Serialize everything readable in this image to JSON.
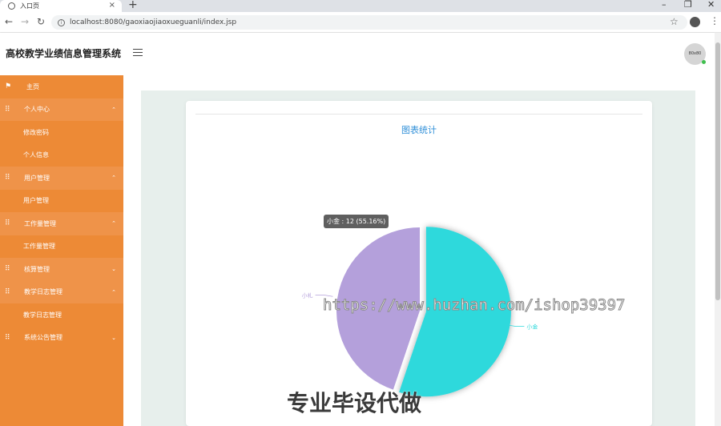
{
  "browser": {
    "tab_title": "入口页",
    "tab_close": "×",
    "new_tab": "+",
    "url": "localhost:8080/gaoxiaojiaoxueguanli/index.jsp",
    "win_min": "–",
    "win_max": "❐",
    "win_close": "✕"
  },
  "header": {
    "title": "高校教学业绩信息管理系统",
    "avatar_text": "80x80"
  },
  "sidebar": {
    "items": [
      {
        "label": "主页"
      },
      {
        "label": "个人中心"
      },
      {
        "label": "修改密码"
      },
      {
        "label": "个人信息"
      },
      {
        "label": "用户管理"
      },
      {
        "label": "用户管理"
      },
      {
        "label": "工作量管理"
      },
      {
        "label": "工作量管理"
      },
      {
        "label": "核算管理"
      },
      {
        "label": "教学日志管理"
      },
      {
        "label": "教学日志管理"
      },
      {
        "label": "系统公告管理"
      }
    ]
  },
  "main": {
    "chart_title": "图表统计",
    "tooltip": "小金 : 12 (55.16%)"
  },
  "chart_data": {
    "type": "pie",
    "title": "图表统计",
    "slices": [
      {
        "name": "小金",
        "percent": 55.16,
        "color": "#2fd9dc"
      },
      {
        "name": "小礼",
        "percent": 44.84,
        "color": "#b4a0db"
      }
    ],
    "highlighted": "小金"
  },
  "overlay": {
    "watermark_url": "https://www.huzhan.com/ishop39397",
    "watermark_text": "专业毕设代做"
  }
}
